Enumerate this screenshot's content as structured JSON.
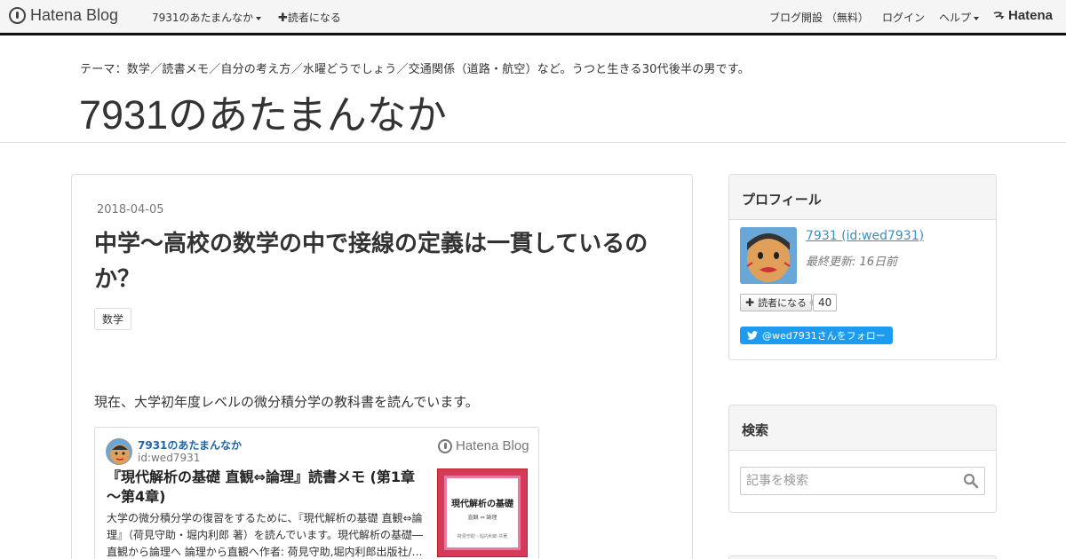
{
  "topbar": {
    "brand": "Hatena Blog",
    "blog_menu": "7931のあたまんなか",
    "subscribe": "読者になる",
    "blog_open": "ブログ開設 （無料）",
    "login": "ログイン",
    "help": "ヘルプ",
    "hatena": "Hatena"
  },
  "header": {
    "description": "テーマ：数学／読書メモ／自分の考え方／水曜どうでしょう／交通関係（道路・航空）など。うつと生きる30代後半の男です。",
    "title": "7931のあたまんなか"
  },
  "entry": {
    "date": "2018-04-05",
    "title": "中学～高校の数学の中で接線の定義は一貫しているのか？",
    "category": "数学",
    "text": "現在、大学初年度レベルの微分積分学の教科書を読んでいます。",
    "embed": {
      "blog_name": "7931のあたまんなか",
      "user_id": "id:wed7931",
      "brand": "Hatena Blog",
      "title": "『現代解析の基礎 直観⇔論理』読書メモ (第1章～第4章)",
      "excerpt": "大学の微分積分学の復習をするために、『現代解析の基礎 直観⇔論理』（荷見守助・堀内利郎 著）を読んでいます。現代解析の基礎―直観から論理へ 論理から直観へ作者: 荷見守助,堀内利郎出版社/…",
      "book_title": "現代解析の基礎",
      "book_subtitle": "直観 ⇔ 論理",
      "book_authors": "荷見守助・堀内利郎 共著"
    }
  },
  "sidebar": {
    "profile": {
      "heading": "プロフィール",
      "name": "7931 (id:wed7931)",
      "updated": "最終更新: 16日前",
      "subscribe": "読者になる",
      "subscriber_count": "40",
      "twitter": "@wed7931さんをフォロー"
    },
    "search": {
      "heading": "検索",
      "placeholder": "記事を検索"
    }
  },
  "colors": {
    "link": "#3a8fbf",
    "twitter": "#1d9bf0",
    "embed_link": "#2266aa"
  }
}
